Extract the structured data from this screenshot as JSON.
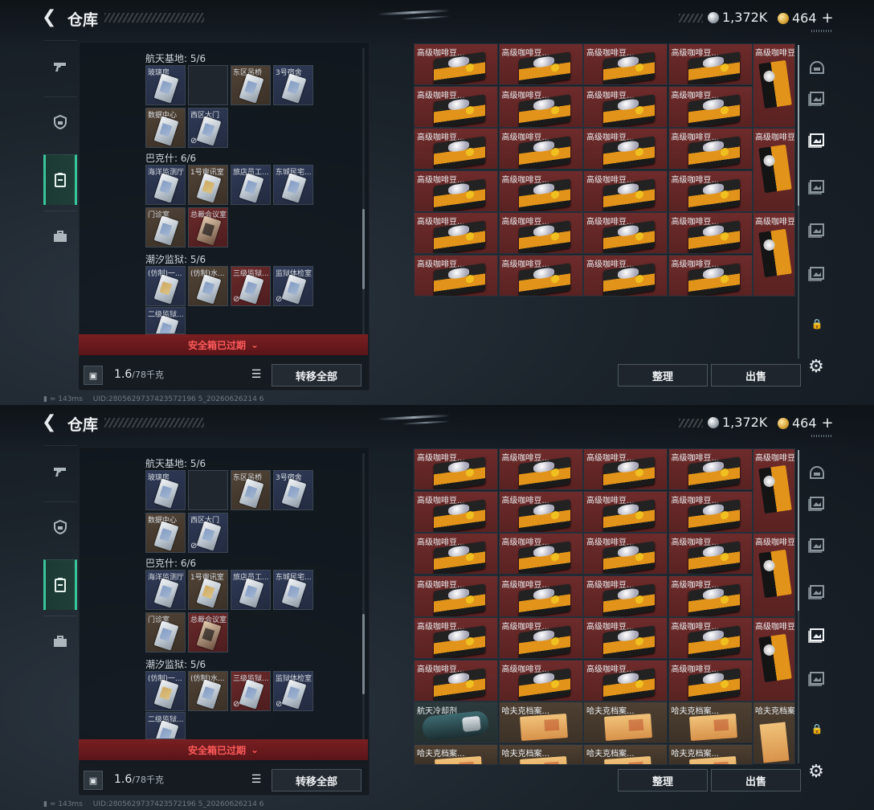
{
  "title": "仓库",
  "currency": {
    "silver": "1,372K",
    "gold": "464"
  },
  "groups": [
    {
      "title": "航天基地: 5/6",
      "slots": [
        {
          "label": "玻璃房",
          "color": "blue",
          "item": "card"
        },
        {
          "label": "",
          "color": "empty",
          "item": "none"
        },
        {
          "label": "东区吊桥",
          "color": "brown",
          "item": "card"
        },
        {
          "label": "3号宿舍",
          "color": "blue",
          "item": "card"
        },
        {
          "label": "数据中心",
          "color": "brown",
          "item": "card"
        },
        {
          "label": "西区大门",
          "color": "blue",
          "item": "card",
          "locked": true
        }
      ]
    },
    {
      "title": "巴克什: 6/6",
      "slots": [
        {
          "label": "海洋监测厅",
          "color": "blue",
          "item": "card"
        },
        {
          "label": "1号审讯室",
          "color": "brown",
          "item": "card-gold"
        },
        {
          "label": "旅店员工...",
          "color": "blue",
          "item": "card"
        },
        {
          "label": "东城民宅...",
          "color": "blue",
          "item": "card"
        },
        {
          "label": "门诊室",
          "color": "brown",
          "item": "card"
        },
        {
          "label": "总裁会议室",
          "color": "red",
          "item": "card-dark"
        }
      ]
    },
    {
      "title": "潮汐监狱: 5/6",
      "slots": [
        {
          "label": "(仿制)一...",
          "color": "blue",
          "item": "card-gold"
        },
        {
          "label": "(仿制)水...",
          "color": "brown",
          "item": "card"
        },
        {
          "label": "三级监狱...",
          "color": "red",
          "item": "card",
          "locked": true
        },
        {
          "label": "监狱体检室",
          "color": "blue",
          "item": "card",
          "locked": true
        },
        {
          "label": "二级监狱...",
          "color": "blue",
          "item": "card"
        }
      ]
    }
  ],
  "expired_text": "安全箱已过期",
  "weight": {
    "current": "1.6",
    "max": "/78千克"
  },
  "transfer_all": "转移全部",
  "sort_label": "整理",
  "sell_label": "出售",
  "items": {
    "coffee": "高级咖啡豆...",
    "coffee_tall": "高级咖啡豆",
    "cooler": "航天冷却剂",
    "file": "哈夫克档案...",
    "file_tall": "哈夫克档案"
  },
  "status_text": "143ms",
  "uid_text": "UID:2805629737423572196 5_20260626214 6",
  "icons": [
    "back-arrow-icon",
    "silver-coin-icon",
    "gold-coin-icon",
    "pistol-icon",
    "shield-icon",
    "card-case-icon",
    "toolbox-icon",
    "bag-icon",
    "list-icon",
    "chevron-down-icon",
    "gear-icon",
    "lock-icon",
    "helmet-icon"
  ]
}
